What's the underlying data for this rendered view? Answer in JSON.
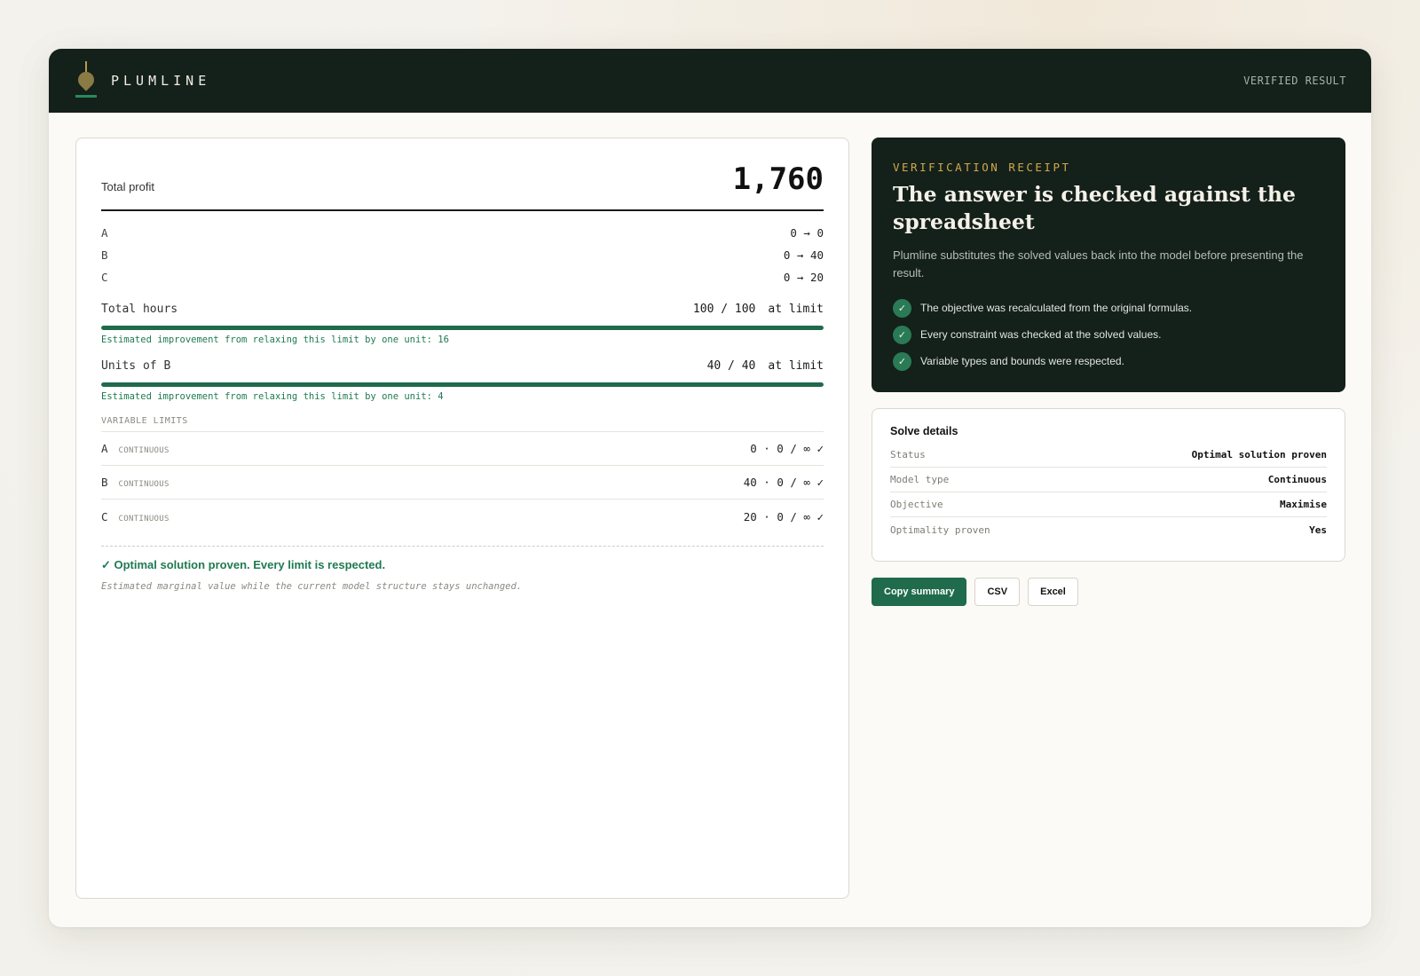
{
  "header": {
    "brand": "PLUMLINE",
    "status": "VERIFIED RESULT"
  },
  "summary": {
    "total_label": "Total profit",
    "total_value": "1,760",
    "variables": [
      {
        "name": "A",
        "change": "0 → 0"
      },
      {
        "name": "B",
        "change": "0 → 40"
      },
      {
        "name": "C",
        "change": "0 → 20"
      }
    ],
    "constraints": [
      {
        "name": "Total hours",
        "usage": "100 / 100",
        "status": "at limit",
        "fill_fraction": 1.0,
        "note": "Estimated improvement from relaxing this limit by one unit: 16"
      },
      {
        "name": "Units of B",
        "usage": "40 / 40",
        "status": "at limit",
        "fill_fraction": 1.0,
        "note": "Estimated improvement from relaxing this limit by one unit: 4"
      }
    ],
    "limits_heading": "VARIABLE LIMITS",
    "variable_limits": [
      {
        "name": "A",
        "type": "CONTINUOUS",
        "value": "0 · 0 / ∞ ✓"
      },
      {
        "name": "B",
        "type": "CONTINUOUS",
        "value": "40 · 0 / ∞ ✓"
      },
      {
        "name": "C",
        "type": "CONTINUOUS",
        "value": "20 · 0 / ∞ ✓"
      }
    ],
    "result_message": "✓ Optimal solution proven. Every limit is respected.",
    "result_note": "Estimated marginal value while the current model structure stays unchanged."
  },
  "receipt": {
    "eyebrow": "VERIFICATION RECEIPT",
    "title": "The answer is checked against the spreadsheet",
    "description": "Plumline substitutes the solved values back into the model before presenting the result.",
    "check_glyph": "✓",
    "checks": [
      "The objective was recalculated from the original formulas.",
      "Every constraint was checked at the solved values.",
      "Variable types and bounds were respected."
    ]
  },
  "details": {
    "title": "Solve details",
    "rows": [
      {
        "key": "Status",
        "value": "Optimal solution proven"
      },
      {
        "key": "Model type",
        "value": "Continuous"
      },
      {
        "key": "Objective",
        "value": "Maximise"
      },
      {
        "key": "Optimality proven",
        "value": "Yes"
      }
    ]
  },
  "actions": {
    "copy_label": "Copy summary",
    "csv_label": "CSV",
    "excel_label": "Excel"
  },
  "colors": {
    "header_bg": "#14201a",
    "accent_green": "#1f6b4c",
    "eyebrow_gold": "#d2a94a"
  }
}
